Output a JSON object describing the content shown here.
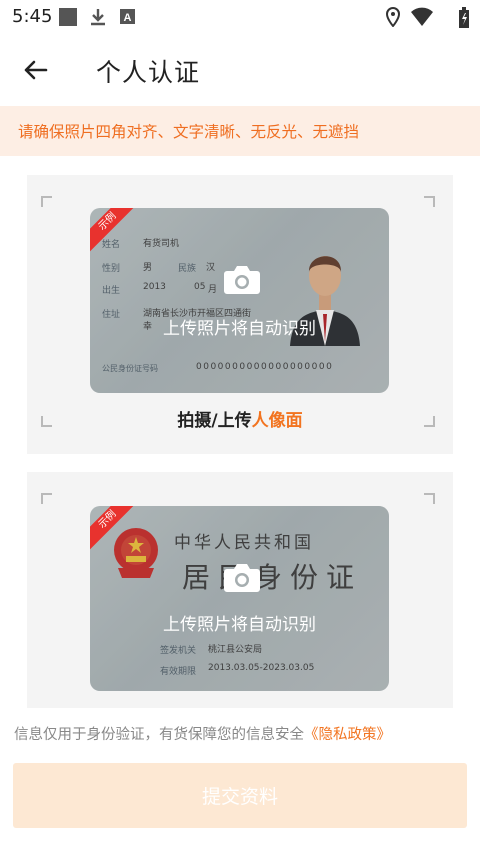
{
  "status_bar": {
    "time": "5:45",
    "icons": [
      "square-notification-icon",
      "download-icon",
      "a-badge-icon",
      "location-icon",
      "wifi-icon",
      "battery-icon"
    ]
  },
  "app_bar": {
    "back_icon": "arrow-left-icon",
    "title": "个人认证"
  },
  "notice": {
    "text": "请确保照片四角对齐、文字清晰、无反光、无遮挡",
    "color": "#ef6e21",
    "background": "#fdeee4"
  },
  "front_card": {
    "ribbon": "示例",
    "upload_text": "上传照片将自动识别",
    "caption_prefix": "拍摄/上传",
    "caption_accent": "人像面",
    "sample": {
      "name_label": "姓名",
      "name_value": "有货司机",
      "gender_label": "性别",
      "gender_value": "男",
      "ethnicity_label": "民族",
      "ethnicity_value": "汉",
      "birth_label": "出生",
      "birth_year": "2013",
      "birth_month": "05",
      "birth_month_label": "月",
      "address_label": "住址",
      "address_value": "湖南省长沙市开福区四通街",
      "address_value2": "幸",
      "id_label": "公民身份证号码",
      "id_value": "0000000000000000000"
    }
  },
  "back_card": {
    "ribbon": "示例",
    "upload_text": "上传照片将自动识别",
    "title_line1": "中华人民共和国",
    "title_line2": "居民身份证",
    "authority_label": "签发机关",
    "authority_value": "桃江县公安局",
    "validity_label": "有效期限",
    "validity_value": "2013.03.05-2023.03.05"
  },
  "footer": {
    "note": "信息仅用于身份验证，有货保障您的信息安全",
    "privacy_link": "《隐私政策》",
    "submit_label": "提交资料"
  },
  "colors": {
    "accent": "#f27420",
    "submit_disabled_bg": "#fde8d3",
    "ribbon": "#e8322e"
  }
}
